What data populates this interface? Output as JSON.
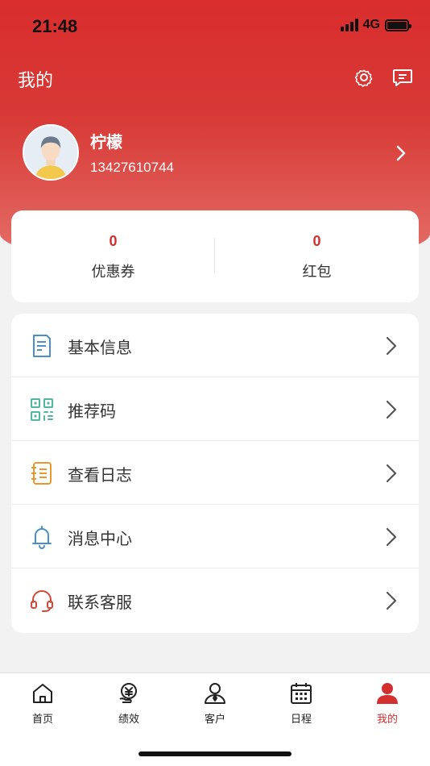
{
  "status_bar": {
    "time": "21:48",
    "network": "4G"
  },
  "nav": {
    "title": "我的",
    "settings_icon": "gear-icon",
    "message_icon": "chat-icon"
  },
  "profile": {
    "name": "柠檬",
    "phone": "13427610744"
  },
  "stats": [
    {
      "value": "0",
      "label": "优惠券"
    },
    {
      "value": "0",
      "label": "红包"
    }
  ],
  "menu": [
    {
      "label": "基本信息",
      "icon": "document-icon",
      "color": "#4a90c8"
    },
    {
      "label": "推荐码",
      "icon": "qr-code-icon",
      "color": "#4fb7a0"
    },
    {
      "label": "查看日志",
      "icon": "log-book-icon",
      "color": "#e8962e"
    },
    {
      "label": "消息中心",
      "icon": "bell-icon",
      "color": "#4a90c8"
    },
    {
      "label": "联系客服",
      "icon": "headset-icon",
      "color": "#d04a3a"
    }
  ],
  "tabs": [
    {
      "label": "首页",
      "icon": "home-icon"
    },
    {
      "label": "绩效",
      "icon": "performance-icon"
    },
    {
      "label": "客户",
      "icon": "customer-icon"
    },
    {
      "label": "日程",
      "icon": "calendar-icon"
    },
    {
      "label": "我的",
      "icon": "user-icon",
      "active": true
    }
  ],
  "colors": {
    "brand_red": "#d32f2f",
    "header_top": "#d92d2d"
  }
}
